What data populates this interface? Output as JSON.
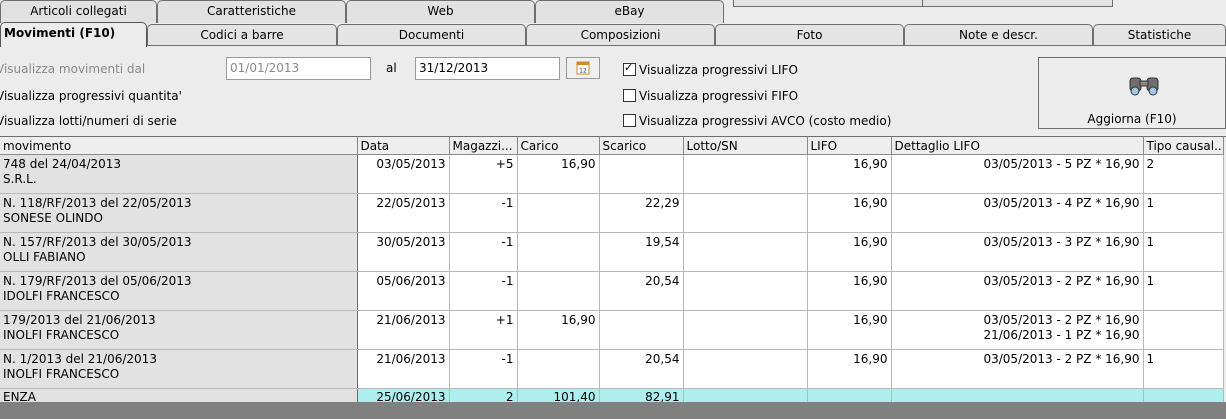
{
  "tabs_row1": [
    "Articoli collegati",
    "Caratteristiche",
    "Web",
    "eBay"
  ],
  "tabs_row2": [
    "Movimenti (F10)",
    "Codici a barre",
    "Documenti",
    "Composizioni",
    "Foto",
    "Note e descr.",
    "Statistiche"
  ],
  "filter": {
    "dal_label": "Visualizza movimenti dal",
    "dal_value": "01/01/2013",
    "al_label": "al",
    "al_value": "31/12/2013",
    "progressivi_quantita": "Visualizza progressivi quantita'",
    "lotti": "Visualizza lotti/numeri di serie"
  },
  "options": {
    "lifo": "Visualizza progressivi LIFO",
    "fifo": "Visualizza progressivi FIFO",
    "avco": "Visualizza progressivi AVCO (costo medio)",
    "lifo_checked": true,
    "fifo_checked": false,
    "avco_checked": false
  },
  "refresh_button": {
    "label": "Aggiorna (F10)",
    "icon": "binoculars-icon"
  },
  "grid": {
    "columns": [
      "movimento",
      "Data",
      "Magazzi...",
      "Carico",
      "Scarico",
      "Lotto/SN",
      "LIFO",
      "Dettaglio LIFO",
      "Tipo causal..."
    ],
    "rows": [
      {
        "mov1": "748 del 24/04/2013",
        "mov2": "S.R.L.",
        "data": "03/05/2013",
        "mag": "+5",
        "carico": "16,90",
        "scarico": "",
        "lotto": "",
        "lifo": "16,90",
        "det1": "03/05/2013 - 5 PZ * 16,90",
        "det2": "",
        "tipo": "2"
      },
      {
        "mov1": "N. 118/RF/2013 del 22/05/2013",
        "mov2": "SONESE OLINDO",
        "data": "22/05/2013",
        "mag": "-1",
        "carico": "",
        "scarico": "22,29",
        "lotto": "",
        "lifo": "16,90",
        "det1": "03/05/2013 - 4 PZ * 16,90",
        "det2": "",
        "tipo": "1"
      },
      {
        "mov1": "N. 157/RF/2013 del 30/05/2013",
        "mov2": "OLLI FABIANO",
        "data": "30/05/2013",
        "mag": "-1",
        "carico": "",
        "scarico": "19,54",
        "lotto": "",
        "lifo": "16,90",
        "det1": "03/05/2013 - 3 PZ * 16,90",
        "det2": "",
        "tipo": "1"
      },
      {
        "mov1": "N. 179/RF/2013 del 05/06/2013",
        "mov2": "IDOLFI FRANCESCO",
        "data": "05/06/2013",
        "mag": "-1",
        "carico": "",
        "scarico": "20,54",
        "lotto": "",
        "lifo": "16,90",
        "det1": "03/05/2013 - 2 PZ * 16,90",
        "det2": "",
        "tipo": "1"
      },
      {
        "mov1": "179/2013 del 21/06/2013",
        "mov2": "INOLFI FRANCESCO",
        "data": "21/06/2013",
        "mag": "+1",
        "carico": "16,90",
        "scarico": "",
        "lotto": "",
        "lifo": "16,90",
        "det1": "03/05/2013 - 2 PZ * 16,90",
        "det2": "21/06/2013 - 1 PZ * 16,90",
        "tipo": ""
      },
      {
        "mov1": "N. 1/2013 del 21/06/2013",
        "mov2": "INOLFI FRANCESCO",
        "data": "21/06/2013",
        "mag": "-1",
        "carico": "",
        "scarico": "20,54",
        "lotto": "",
        "lifo": "16,90",
        "det1": "03/05/2013 - 2 PZ * 16,90",
        "det2": "",
        "tipo": "1"
      }
    ],
    "total": {
      "mov": "ENZA",
      "data": "25/06/2013",
      "mag": "2",
      "carico": "101,40",
      "scarico": "82,91"
    }
  }
}
